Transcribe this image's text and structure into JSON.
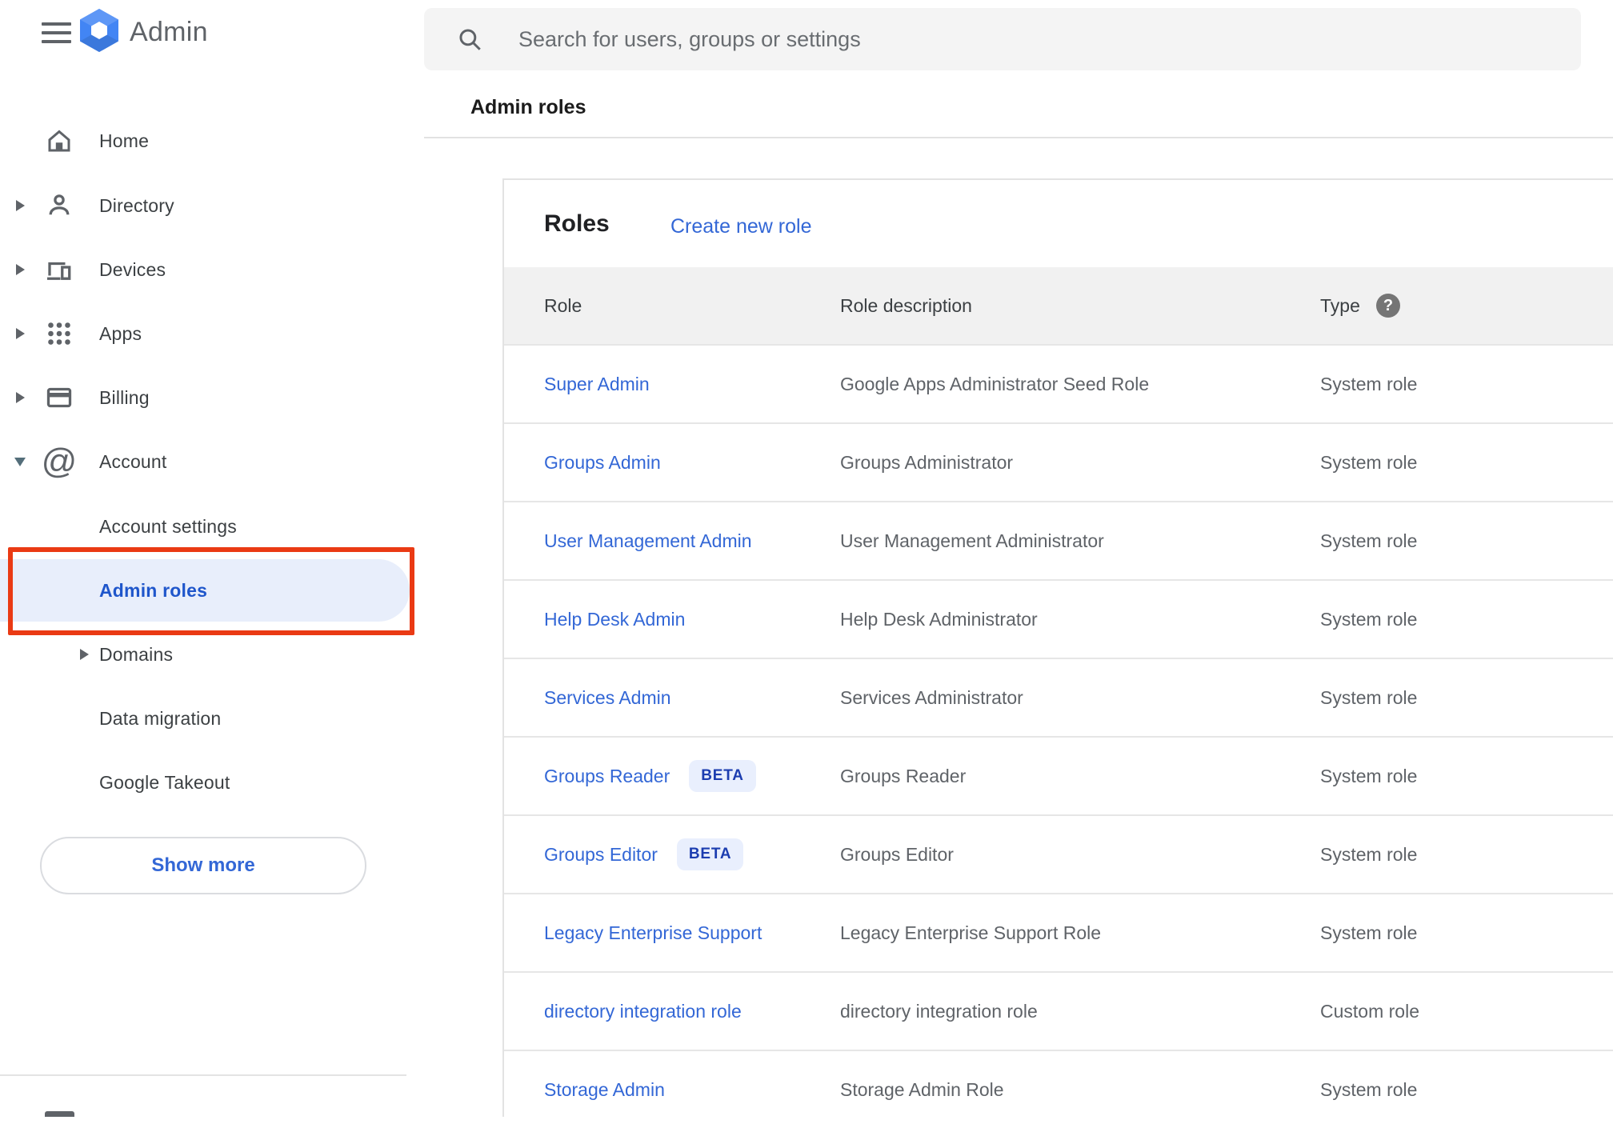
{
  "topbar": {
    "logo_text": "Admin",
    "search_placeholder": "Search for users, groups or settings",
    "breadcrumb": "Admin roles"
  },
  "sidebar": {
    "items": [
      {
        "label": "Home"
      },
      {
        "label": "Directory"
      },
      {
        "label": "Devices"
      },
      {
        "label": "Apps"
      },
      {
        "label": "Billing"
      },
      {
        "label": "Account"
      },
      {
        "label": "Account settings"
      },
      {
        "label": "Admin roles",
        "selected": true
      },
      {
        "label": "Domains"
      },
      {
        "label": "Data migration"
      },
      {
        "label": "Google Takeout"
      }
    ],
    "show_more_label": "Show more"
  },
  "main": {
    "card_title": "Roles",
    "create_link": "Create new role",
    "table": {
      "columns": [
        "Role",
        "Role description",
        "Type"
      ],
      "beta_label": "BETA",
      "rows": [
        {
          "role": "Super Admin",
          "description": "Google Apps Administrator Seed Role",
          "type": "System role"
        },
        {
          "role": "Groups Admin",
          "description": "Groups Administrator",
          "type": "System role"
        },
        {
          "role": "User Management Admin",
          "description": "User Management Administrator",
          "type": "System role"
        },
        {
          "role": "Help Desk Admin",
          "description": "Help Desk Administrator",
          "type": "System role"
        },
        {
          "role": "Services Admin",
          "description": "Services Administrator",
          "type": "System role"
        },
        {
          "role": "Groups Reader",
          "beta": true,
          "description": "Groups Reader",
          "type": "System role"
        },
        {
          "role": "Groups Editor",
          "beta": true,
          "description": "Groups Editor",
          "type": "System role"
        },
        {
          "role": "Legacy Enterprise Support",
          "description": "Legacy Enterprise Support Role",
          "type": "System role"
        },
        {
          "role": "directory integration role",
          "description": "directory integration role",
          "type": "Custom role"
        },
        {
          "role": "Storage Admin",
          "description": "Storage Admin Role",
          "type": "System role"
        }
      ]
    }
  },
  "colors": {
    "link_blue": "#3367d6",
    "selected_item_blue": "#1f56cb",
    "selected_pill_bg": "#e8eefb",
    "beta_badge_bg": "#e9effd",
    "beta_badge_text": "#1c3db0",
    "annotation_red": "#ea3a14",
    "header_row_bg": "#f1f1f1",
    "search_bar_bg": "#f4f4f4",
    "icon_gray": "#5f6368",
    "text_gray": "#3c4043"
  }
}
